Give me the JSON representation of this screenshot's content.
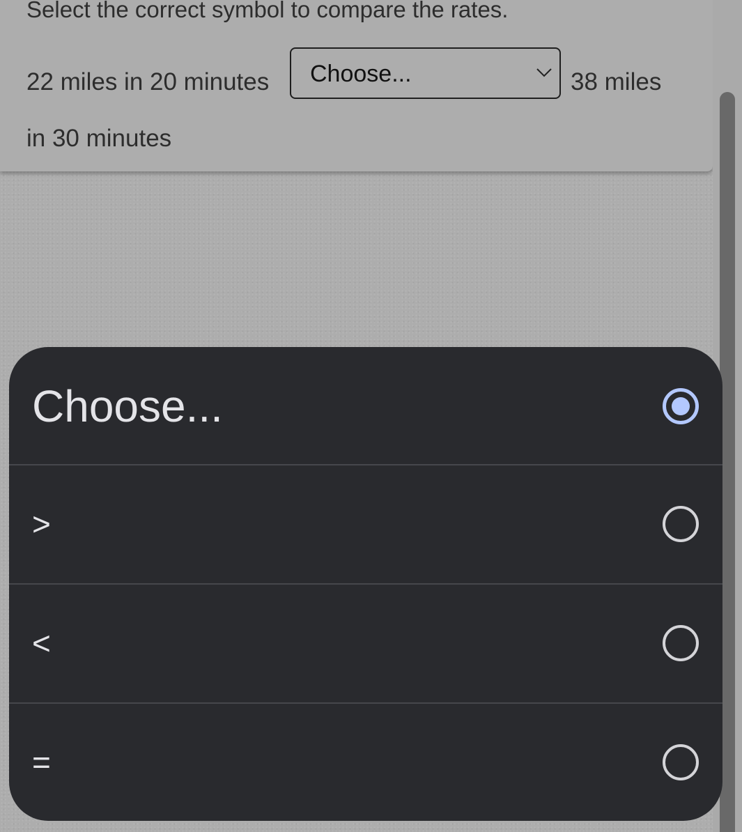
{
  "question": {
    "prompt": "Select the correct symbol to compare the rates.",
    "left_rate": "22 miles in 20 minutes",
    "right_rate_line1": "38 miles",
    "right_rate_line2": "in 30 minutes",
    "select": {
      "value": "Choose...",
      "icon": "chevron-down-icon"
    }
  },
  "picker": {
    "selected_index": 0,
    "options": [
      {
        "label": "Choose...",
        "selected": true
      },
      {
        "label": ">",
        "selected": false
      },
      {
        "label": "<",
        "selected": false
      },
      {
        "label": "=",
        "selected": false
      }
    ],
    "colors": {
      "background": "#292a2e",
      "divider": "#46474c",
      "text": "#e4e4e8",
      "radio_selected": "#b3c8ff",
      "radio_unselected": "#d4d4d8"
    }
  },
  "overlay": {
    "scrim_color": "#adadad"
  }
}
